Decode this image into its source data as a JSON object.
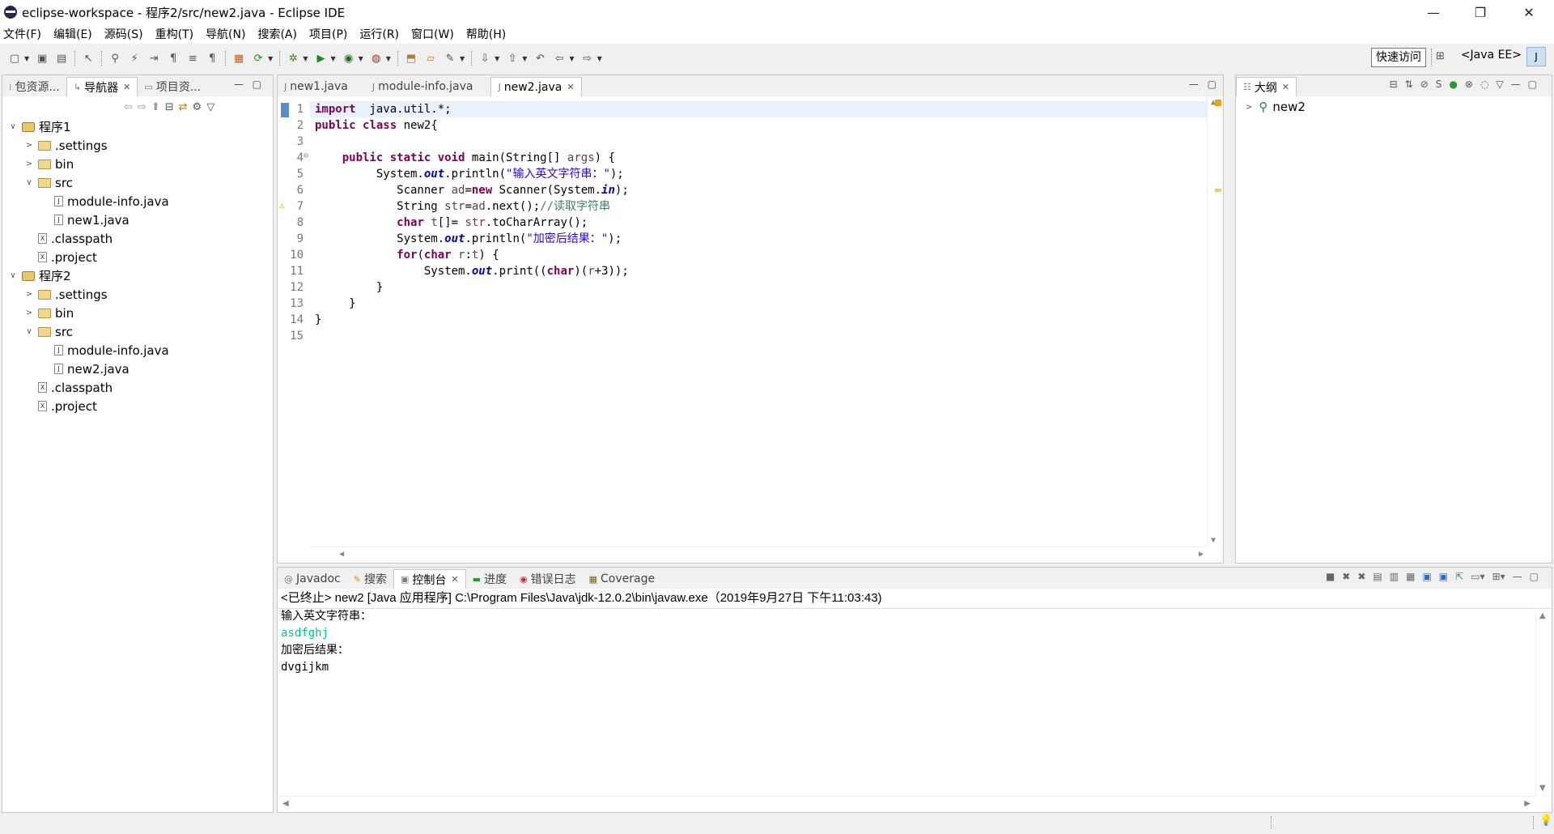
{
  "window": {
    "title": "eclipse-workspace - 程序2/src/new2.java - Eclipse IDE",
    "controls": {
      "minimize": "—",
      "restore": "❐",
      "close": "✕"
    }
  },
  "menu": [
    "文件(F)",
    "编辑(E)",
    "源码(S)",
    "重构(T)",
    "导航(N)",
    "搜索(A)",
    "项目(P)",
    "运行(R)",
    "窗口(W)",
    "帮助(H)"
  ],
  "toolbar": {
    "quick_access": "快速访问",
    "perspective": "<Java EE>"
  },
  "left_panel": {
    "tabs": [
      {
        "label": "包资源...",
        "icon": "package-explorer-icon",
        "active": false
      },
      {
        "label": "导航器",
        "icon": "navigator-icon",
        "active": true,
        "close": "✕"
      },
      {
        "label": "项目资...",
        "icon": "project-explorer-icon",
        "active": false
      }
    ],
    "tree": [
      {
        "label": "程序1",
        "level": 0,
        "type": "project",
        "twisty": "∨"
      },
      {
        "label": ".settings",
        "level": 1,
        "type": "folder",
        "twisty": ">"
      },
      {
        "label": "bin",
        "level": 1,
        "type": "folder",
        "twisty": ">"
      },
      {
        "label": "src",
        "level": 1,
        "type": "folder",
        "twisty": "∨"
      },
      {
        "label": "module-info.java",
        "level": 2,
        "type": "java"
      },
      {
        "label": "new1.java",
        "level": 2,
        "type": "java"
      },
      {
        "label": ".classpath",
        "level": 1,
        "type": "xml"
      },
      {
        "label": ".project",
        "level": 1,
        "type": "xml"
      },
      {
        "label": "程序2",
        "level": 0,
        "type": "project",
        "twisty": "∨"
      },
      {
        "label": ".settings",
        "level": 1,
        "type": "folder",
        "twisty": ">"
      },
      {
        "label": "bin",
        "level": 1,
        "type": "folder",
        "twisty": ">"
      },
      {
        "label": "src",
        "level": 1,
        "type": "folder",
        "twisty": "∨"
      },
      {
        "label": "module-info.java",
        "level": 2,
        "type": "java"
      },
      {
        "label": "new2.java",
        "level": 2,
        "type": "java"
      },
      {
        "label": ".classpath",
        "level": 1,
        "type": "xml"
      },
      {
        "label": ".project",
        "level": 1,
        "type": "xml"
      }
    ]
  },
  "editor": {
    "tabs": [
      {
        "label": "new1.java",
        "active": false
      },
      {
        "label": "module-info.java",
        "active": false
      },
      {
        "label": "new2.java",
        "active": true,
        "close": "✕"
      }
    ],
    "line_numbers": [
      "1",
      "2",
      "3",
      "4",
      "5",
      "6",
      "7",
      "8",
      "9",
      "10",
      "11",
      "12",
      "13",
      "14",
      "15"
    ],
    "fold_marker": "⊖",
    "lines": [
      [
        [
          "kw",
          "import"
        ],
        [
          "",
          "  java.util.*;"
        ]
      ],
      [
        [
          "kw",
          "public"
        ],
        [
          "",
          " "
        ],
        [
          "kw",
          "class"
        ],
        [
          "",
          " new2{"
        ]
      ],
      [],
      [
        [
          "",
          "    "
        ],
        [
          "kw",
          "public"
        ],
        [
          "",
          " "
        ],
        [
          "kw",
          "static"
        ],
        [
          "",
          " "
        ],
        [
          "kw",
          "void"
        ],
        [
          "",
          " main(String[] "
        ],
        [
          "vr",
          "args"
        ],
        [
          "",
          ") {"
        ]
      ],
      [
        [
          "",
          "         System."
        ],
        [
          "it",
          "out"
        ],
        [
          "",
          ".println("
        ],
        [
          "st",
          "\"输入英文字符串：\""
        ],
        [
          "",
          ");"
        ]
      ],
      [
        [
          "",
          "            Scanner "
        ],
        [
          "vr",
          "ad"
        ],
        [
          "",
          "="
        ],
        [
          "kw",
          "new"
        ],
        [
          "",
          " Scanner(System."
        ],
        [
          "it",
          "in"
        ],
        [
          "",
          ");"
        ]
      ],
      [
        [
          "",
          "            String "
        ],
        [
          "vr",
          "str"
        ],
        [
          "",
          "="
        ],
        [
          "vr",
          "ad"
        ],
        [
          "",
          ".next();"
        ],
        [
          "cm",
          "//读取字符串"
        ]
      ],
      [
        [
          "",
          "            "
        ],
        [
          "kw",
          "char"
        ],
        [
          "",
          " "
        ],
        [
          "vr",
          "t"
        ],
        [
          "",
          "[]= "
        ],
        [
          "vr",
          "str"
        ],
        [
          "",
          ".toCharArray();"
        ]
      ],
      [
        [
          "",
          "            System."
        ],
        [
          "it",
          "out"
        ],
        [
          "",
          ".println("
        ],
        [
          "st",
          "\"加密后结果：\""
        ],
        [
          "",
          ");"
        ]
      ],
      [
        [
          "",
          "            "
        ],
        [
          "kw",
          "for"
        ],
        [
          "",
          "("
        ],
        [
          "kw",
          "char"
        ],
        [
          "",
          " "
        ],
        [
          "vr",
          "r"
        ],
        [
          "",
          ":"
        ],
        [
          "vr",
          "t"
        ],
        [
          "",
          ") {"
        ]
      ],
      [
        [
          "",
          "                System."
        ],
        [
          "it",
          "out"
        ],
        [
          "",
          ".print(("
        ],
        [
          "kw",
          "char"
        ],
        [
          "",
          ")("
        ],
        [
          "vr",
          "r"
        ],
        [
          "",
          "+3));"
        ]
      ],
      [
        [
          "",
          "         }"
        ]
      ],
      [
        [
          "",
          "     }"
        ]
      ],
      [
        [
          "",
          "}"
        ]
      ],
      []
    ]
  },
  "outline": {
    "tab_label": "大纲",
    "close": "✕",
    "item": "new2"
  },
  "console": {
    "tabs": [
      {
        "label": "Javadoc",
        "icon": "@",
        "active": false
      },
      {
        "label": "搜索",
        "icon": "search-icon",
        "active": false
      },
      {
        "label": "控制台",
        "icon": "console-icon",
        "active": true,
        "close": "✕"
      },
      {
        "label": "进度",
        "icon": "progress-icon",
        "active": false
      },
      {
        "label": "错误日志",
        "icon": "error-log-icon",
        "active": false
      },
      {
        "label": "Coverage",
        "icon": "coverage-icon",
        "active": false
      }
    ],
    "header": "<已终止> new2 [Java 应用程序] C:\\Program Files\\Java\\jdk-12.0.2\\bin\\javaw.exe（2019年9月27日 下午11:03:43)",
    "output": [
      "输入英文字符串：",
      "asdfghj",
      "加密后结果：",
      "dvgijkm"
    ]
  }
}
